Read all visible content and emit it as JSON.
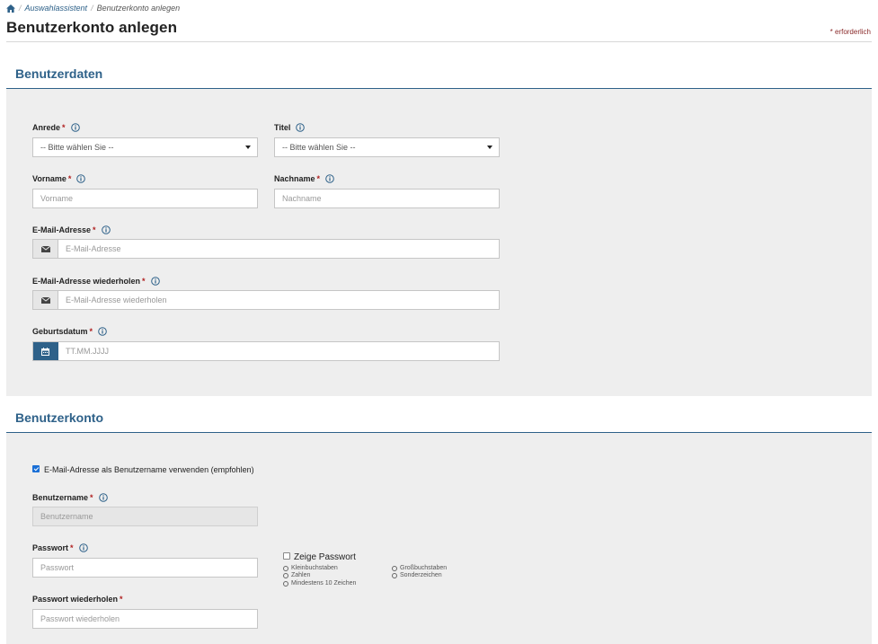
{
  "breadcrumb": {
    "items": [
      {
        "label": "Auswahlassistent"
      },
      {
        "label": "Benutzerkonto anlegen"
      }
    ],
    "separator": "/"
  },
  "page": {
    "title": "Benutzerkonto anlegen",
    "required_note": "* erforderlich"
  },
  "required_mark": "*",
  "sections": {
    "benutzerdaten": {
      "title": "Benutzerdaten",
      "anrede": {
        "label": "Anrede",
        "selected": "-- Bitte wählen Sie --"
      },
      "titel": {
        "label": "Titel",
        "selected": "-- Bitte wählen Sie --"
      },
      "vorname": {
        "label": "Vorname",
        "placeholder": "Vorname"
      },
      "nachname": {
        "label": "Nachname",
        "placeholder": "Nachname"
      },
      "email": {
        "label": "E-Mail-Adresse",
        "placeholder": "E-Mail-Adresse"
      },
      "email_repeat": {
        "label": "E-Mail-Adresse wiederholen",
        "placeholder": "E-Mail-Adresse wiederholen"
      },
      "geburtsdatum": {
        "label": "Geburtsdatum",
        "placeholder": "TT.MM.JJJJ"
      }
    },
    "benutzerkonto": {
      "title": "Benutzerkonto",
      "use_email_checkbox": {
        "label": "E-Mail-Adresse als Benutzername verwenden (empfohlen)",
        "checked": true
      },
      "benutzername": {
        "label": "Benutzername",
        "placeholder": "Benutzername"
      },
      "passwort": {
        "label": "Passwort",
        "placeholder": "Passwort"
      },
      "passwort_repeat": {
        "label": "Passwort wiederholen",
        "placeholder": "Passwort wiederholen"
      },
      "show_password": {
        "label": "Zeige Passwort",
        "checked": false
      },
      "password_rules": {
        "left": [
          "Kleinbuchstaben",
          "Zahlen",
          "Mindestens 10 Zeichen"
        ],
        "right": [
          "Großbuchstaben",
          "Sonderzeichen"
        ]
      }
    }
  },
  "colors": {
    "primary": "#2e6189",
    "required": "#b02020",
    "panel_bg": "#eeeeee",
    "checkbox_accent": "#1a6fd6"
  },
  "icons": {
    "home": "home-icon",
    "info": "info-icon",
    "envelope": "envelope-icon",
    "calendar": "calendar-icon",
    "caret": "caret-down-icon"
  }
}
